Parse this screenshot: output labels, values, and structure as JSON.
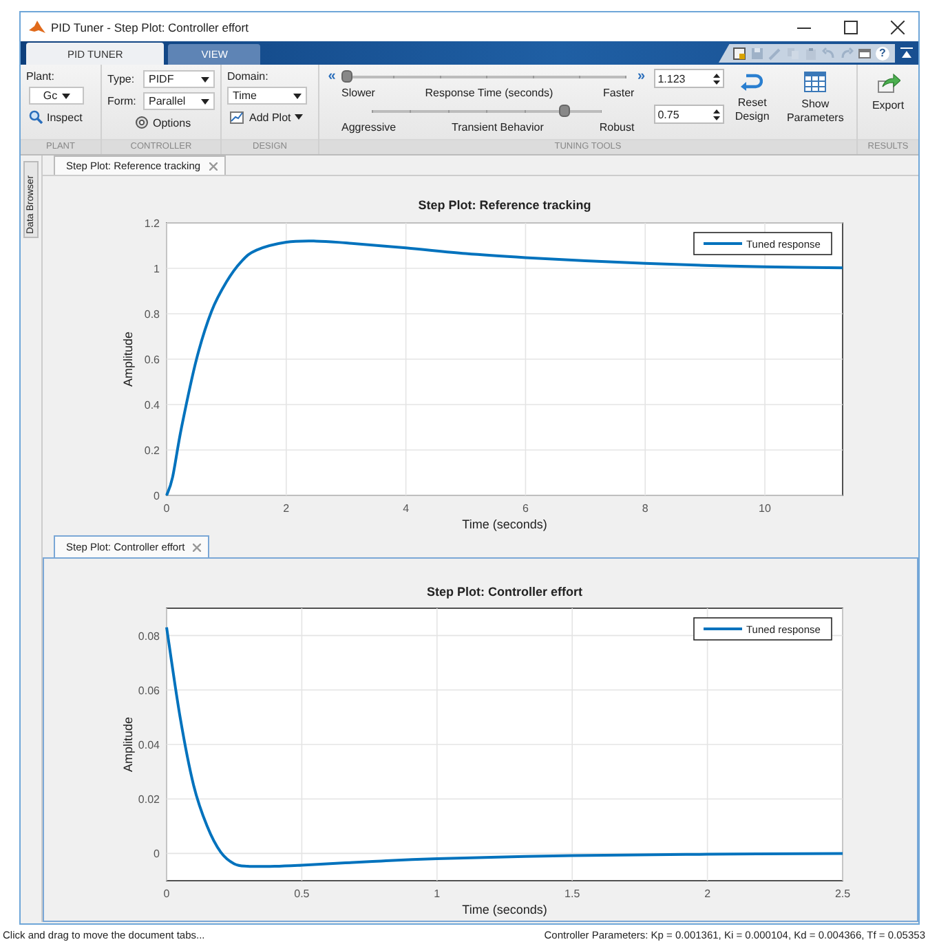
{
  "window": {
    "title": "PID Tuner - Step Plot: Controller effort"
  },
  "ribbon_tabs": [
    {
      "label": "PID TUNER",
      "selected": true
    },
    {
      "label": "VIEW",
      "selected": false
    }
  ],
  "quick_access": {
    "help": "?"
  },
  "plant_section": {
    "title": "PLANT",
    "plant_label": "Plant:",
    "plant_value": "Gc",
    "inspect_button": "Inspect"
  },
  "controller_section": {
    "title": "CONTROLLER",
    "type_label": "Type:",
    "type_value": "PIDF",
    "form_label": "Form:",
    "form_value": "Parallel",
    "options_button": "Options"
  },
  "design_section": {
    "title": "DESIGN",
    "domain_label": "Domain:",
    "domain_value": "Time",
    "add_plot_button": "Add Plot"
  },
  "tuning_section": {
    "title": "TUNING TOOLS",
    "sliders": [
      {
        "left_button": "«",
        "right_button": "»",
        "left_label": "Slower",
        "center_label": "Response Time (seconds)",
        "right_label": "Faster",
        "level": 0.0,
        "spinner": "1.123"
      },
      {
        "left_label": "Aggressive",
        "center_label": "Transient Behavior",
        "right_label": "Robust",
        "level": 0.84,
        "spinner": "0.75"
      }
    ],
    "reset_button": "Reset Design",
    "show_parameters_button": "Show Parameters"
  },
  "results_section": {
    "title": "RESULTS",
    "export_button": "Export"
  },
  "data_browser_tab": "Data Browser",
  "documents": [
    {
      "tab": "Step Plot: Reference tracking",
      "selected": false,
      "chart_data": {
        "type": "line",
        "grid": true,
        "title": "Step Plot: Reference tracking",
        "xlabel": "Time (seconds)",
        "ylabel": "Amplitude",
        "xlim": [
          0,
          11.3
        ],
        "ylim": [
          0,
          1.2
        ],
        "xticks": [
          0,
          2,
          4,
          6,
          8,
          10
        ],
        "yticks": [
          0,
          0.2,
          0.4,
          0.6,
          0.8,
          1,
          1.2
        ],
        "x": [
          0,
          0.1,
          0.25,
          0.5,
          0.75,
          1,
          1.25,
          1.5,
          2,
          2.5,
          3,
          4,
          5,
          6,
          7,
          8,
          9,
          10,
          11.3
        ],
        "series": [
          {
            "name": "Tuned response",
            "color": "#0072bd",
            "values": [
              0,
              0.08,
              0.3,
              0.6,
              0.81,
              0.94,
              1.03,
              1.08,
              1.115,
              1.12,
              1.112,
              1.09,
              1.065,
              1.047,
              1.033,
              1.022,
              1.013,
              1.007,
              1.002
            ]
          }
        ]
      }
    },
    {
      "tab": "Step Plot: Controller effort",
      "selected": true,
      "chart_data": {
        "type": "line",
        "grid": true,
        "title": "Step Plot: Controller effort",
        "xlabel": "Time (seconds)",
        "ylabel": "Amplitude",
        "xlim": [
          0,
          2.5
        ],
        "ylim": [
          -0.01,
          0.09
        ],
        "xticks": [
          0,
          0.5,
          1,
          1.5,
          2,
          2.5
        ],
        "yticks": [
          0,
          0.02,
          0.04,
          0.06,
          0.08
        ],
        "x": [
          0,
          0.05,
          0.1,
          0.15,
          0.2,
          0.25,
          0.3,
          0.4,
          0.5,
          0.75,
          1,
          1.5,
          2,
          2.5
        ],
        "series": [
          {
            "name": "Tuned response",
            "color": "#0072bd",
            "values": [
              0.083,
              0.05,
              0.025,
              0.01,
              0.0005,
              -0.0038,
              -0.0047,
              -0.0047,
              -0.0043,
              -0.003,
              -0.0019,
              -0.0008,
              -0.0003,
              0
            ]
          }
        ]
      }
    }
  ],
  "status_bar": {
    "hint": "Click and drag to move the document tabs...",
    "parameters": "Controller Parameters: Kp = 0.001361, Ki = 0.000104, Kd = 0.004366, Tf = 0.05353"
  }
}
